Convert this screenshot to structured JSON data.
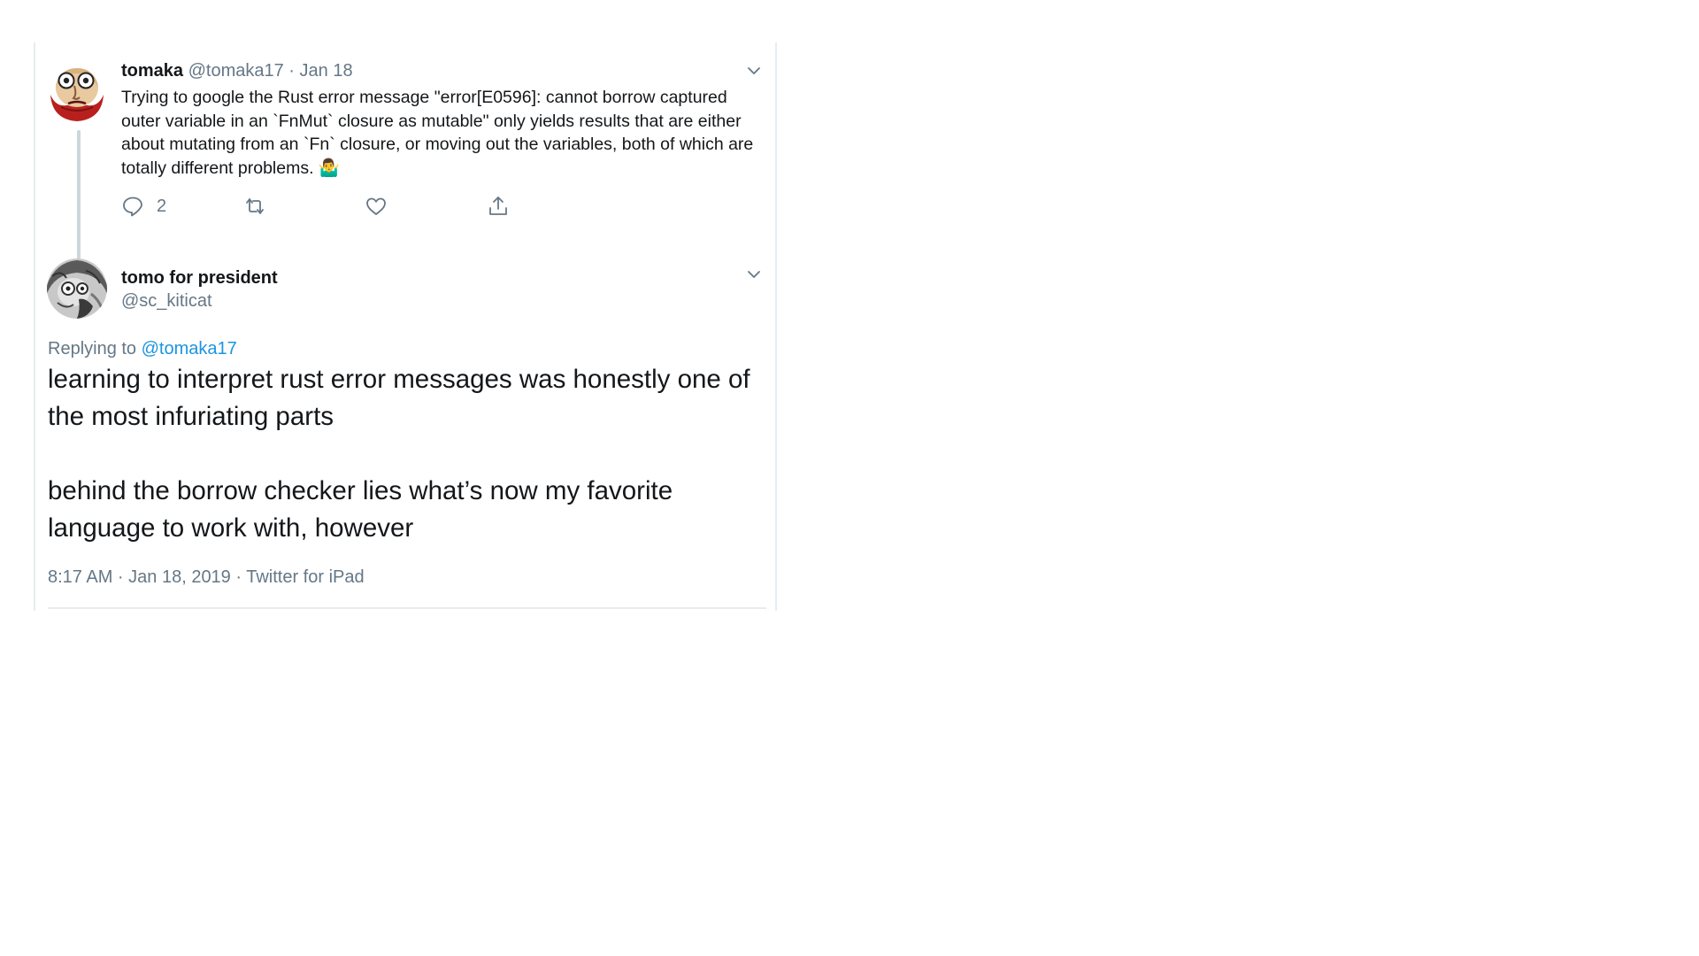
{
  "parent_tweet": {
    "display_name": "tomaka",
    "handle": "@tomaka17",
    "separator": "·",
    "date": "Jan 18",
    "text": "Trying to google the Rust error message \"error[E0596]: cannot borrow captured outer variable in an `FnMut` closure as mutable\" only yields results that are either about mutating from an `Fn` closure, or moving out the variables, both of which are totally different problems. 🤷‍♂️",
    "reply_count": "2",
    "icons": {
      "avatar": "cartoon-face-avatar",
      "reply": "reply-icon",
      "retweet": "retweet-icon",
      "like": "heart-icon",
      "share": "share-icon",
      "menu": "chevron-down-icon"
    }
  },
  "main_tweet": {
    "display_name": "tomo for president",
    "handle": "@sc_kiticat",
    "replying_label": "Replying to",
    "replying_mention": "@tomaka17",
    "paragraphs": [
      "learning to interpret rust error messages was honestly one of the most infuriating parts",
      "behind the borrow checker lies what’s now my favorite language to work with, however"
    ],
    "timestamp": "8:17 AM · Jan 18, 2019 · Twitter for iPad",
    "icons": {
      "avatar": "manga-sketch-avatar",
      "menu": "chevron-down-icon"
    }
  },
  "colors": {
    "text_primary": "#14171a",
    "text_secondary": "#657786",
    "link": "#1b95e0",
    "border": "#e6ecf0",
    "thread_line": "#ccd6dd"
  }
}
